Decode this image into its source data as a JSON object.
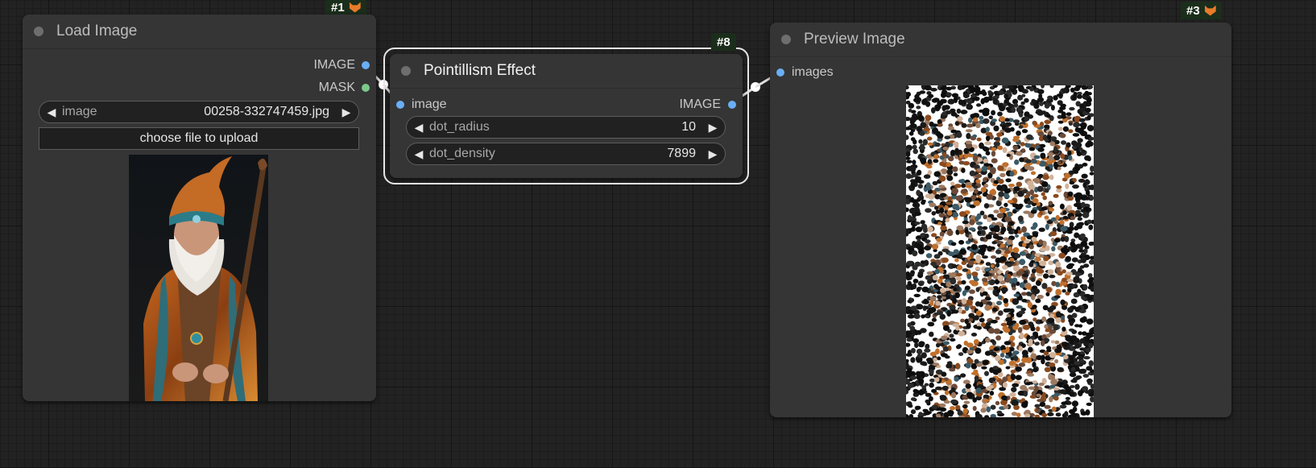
{
  "nodes": {
    "load_image": {
      "id_badge": "#1",
      "title": "Load Image",
      "outputs": [
        "IMAGE",
        "MASK"
      ],
      "image_widget": {
        "label": "image",
        "value": "00258-332747459.jpg"
      },
      "upload_label": "choose file to upload",
      "preview_alt": "wizard portrait"
    },
    "pointillism": {
      "id_badge": "#8",
      "title": "Pointillism Effect",
      "input": "image",
      "output": "IMAGE",
      "widgets": [
        {
          "label": "dot_radius",
          "value": "10"
        },
        {
          "label": "dot_density",
          "value": "7899"
        }
      ]
    },
    "preview": {
      "id_badge": "#3",
      "title": "Preview Image",
      "input": "images"
    }
  },
  "colors": {
    "image_slot": "#6aaef5",
    "mask_slot": "#7cc98a",
    "node_bg": "#353535",
    "badge_bg": "#1b2e1b"
  },
  "icons": {
    "title_dot": "status-dot-icon",
    "fox": "fox-icon",
    "left": "left-arrow-icon",
    "right": "right-arrow-icon"
  }
}
